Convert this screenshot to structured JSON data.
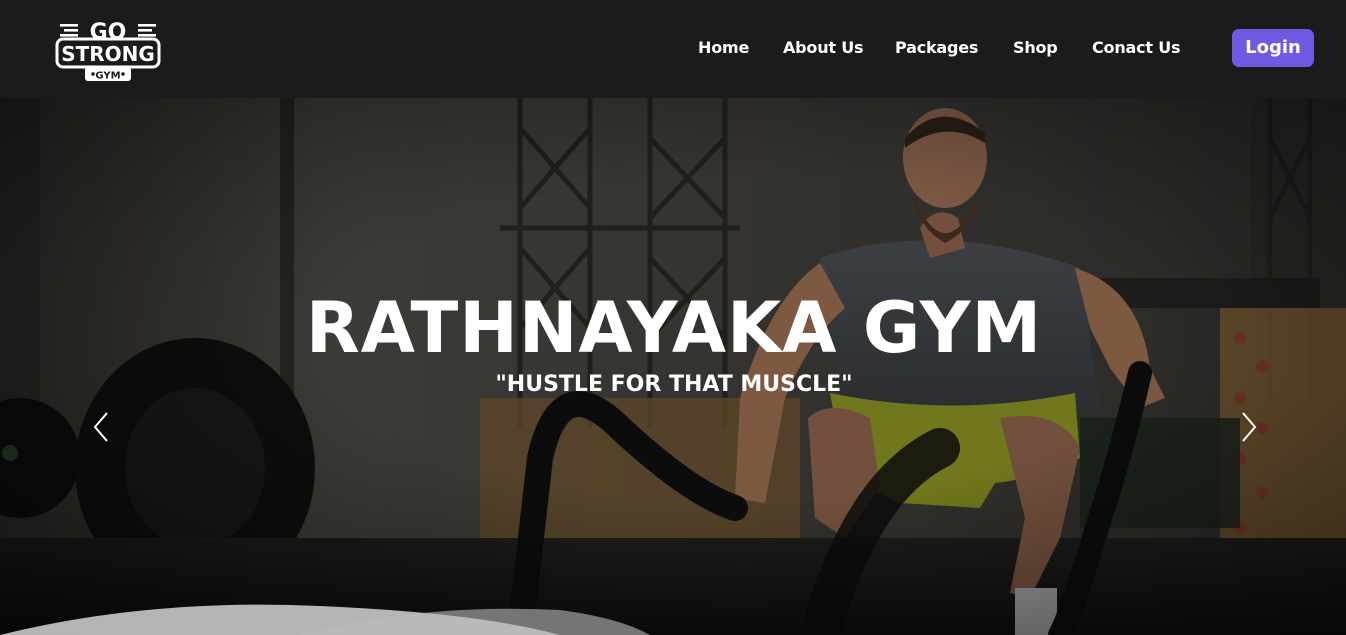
{
  "logo": {
    "top_text": "GO",
    "main_text": "STRONG",
    "sub_text": "GYM"
  },
  "nav": {
    "items": [
      {
        "label": "Home"
      },
      {
        "label": "About Us"
      },
      {
        "label": "Packages"
      },
      {
        "label": "Shop"
      },
      {
        "label": "Conact Us"
      }
    ],
    "login_label": "Login"
  },
  "hero": {
    "title": "RATHNAYAKA GYM",
    "subtitle": "\"HUSTLE FOR THAT MUSCLE\""
  },
  "colors": {
    "navbar": "#1b1b1b",
    "accent": "#7159e4",
    "text": "#ffffff"
  },
  "icons": {
    "prev": "chevron-left-icon",
    "next": "chevron-right-icon"
  }
}
